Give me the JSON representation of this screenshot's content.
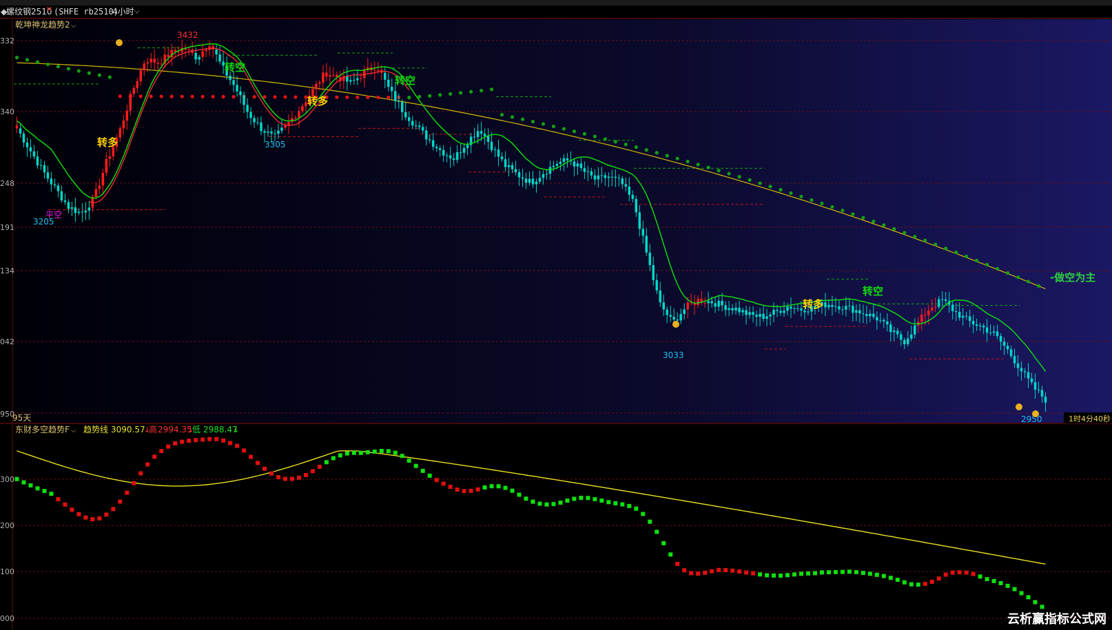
{
  "header": {
    "symbol_name": "螺纹钢2510",
    "symbol_mark": "M",
    "symbol_code": "(SHFE rb2510)",
    "period": "4小时"
  },
  "main_panel": {
    "indicator_name": "乾坤神龙趋势2",
    "days_label": "95天",
    "countdown": "1时4分40秒",
    "right_annotation": "-做空为主",
    "y_labels": [
      "332",
      "340",
      "248",
      "191",
      "134",
      "042",
      "950"
    ],
    "price_labels": [
      "3432",
      "3305",
      "3205",
      "3033",
      "2950"
    ],
    "signal_labels": {
      "long1": "转多",
      "short1": "转空",
      "long2": "转多",
      "short2": "转空",
      "long3": "转多",
      "short3": "转空",
      "flat": "平空"
    }
  },
  "sub_panel": {
    "indicator_name": "东财多空趋势F",
    "trend_label": "趋势线",
    "trend_value": "3090.57",
    "high_label": "高",
    "high_value": "2994.35",
    "low_label": "低",
    "low_value": "2988.47",
    "y_labels": [
      "300",
      "200",
      "100",
      "000"
    ]
  },
  "watermark": "云析赢指标公式网",
  "colors": {
    "up": "#ff1c1c",
    "down": "#00d6c8",
    "ma_green": "#10d810",
    "ma_red": "#ff3030",
    "long_line": "#d6b800",
    "dots_green": "#14a014",
    "dots_red": "#e01414",
    "yellow_label": "#ffd000",
    "cyan_label": "#20c0f0",
    "panel_bg": "#0e0c38"
  },
  "chart_data": {
    "type": "candlestick",
    "title": "螺纹钢2510 (SHFE rb2510) 4小时",
    "close_path": [
      3318,
      3290,
      3262,
      3238,
      3214,
      3205,
      3225,
      3275,
      3315,
      3368,
      3410,
      3405,
      3418,
      3425,
      3412,
      3432,
      3398,
      3372,
      3338,
      3318,
      3305,
      3322,
      3344,
      3368,
      3392,
      3386,
      3378,
      3392,
      3402,
      3368,
      3342,
      3322,
      3304,
      3288,
      3278,
      3300,
      3318,
      3292,
      3268,
      3256,
      3246,
      3260,
      3272,
      3276,
      3262,
      3250,
      3254,
      3246,
      3218,
      3150,
      3085,
      3060,
      3080,
      3090,
      3088,
      3082,
      3078,
      3070,
      3068,
      3074,
      3082,
      3078,
      3080,
      3085,
      3082,
      3078,
      3072,
      3065,
      3048,
      3035,
      3058,
      3080,
      3090,
      3074,
      3062,
      3055,
      3045,
      3025,
      3000,
      2975,
      2958
    ]
  }
}
